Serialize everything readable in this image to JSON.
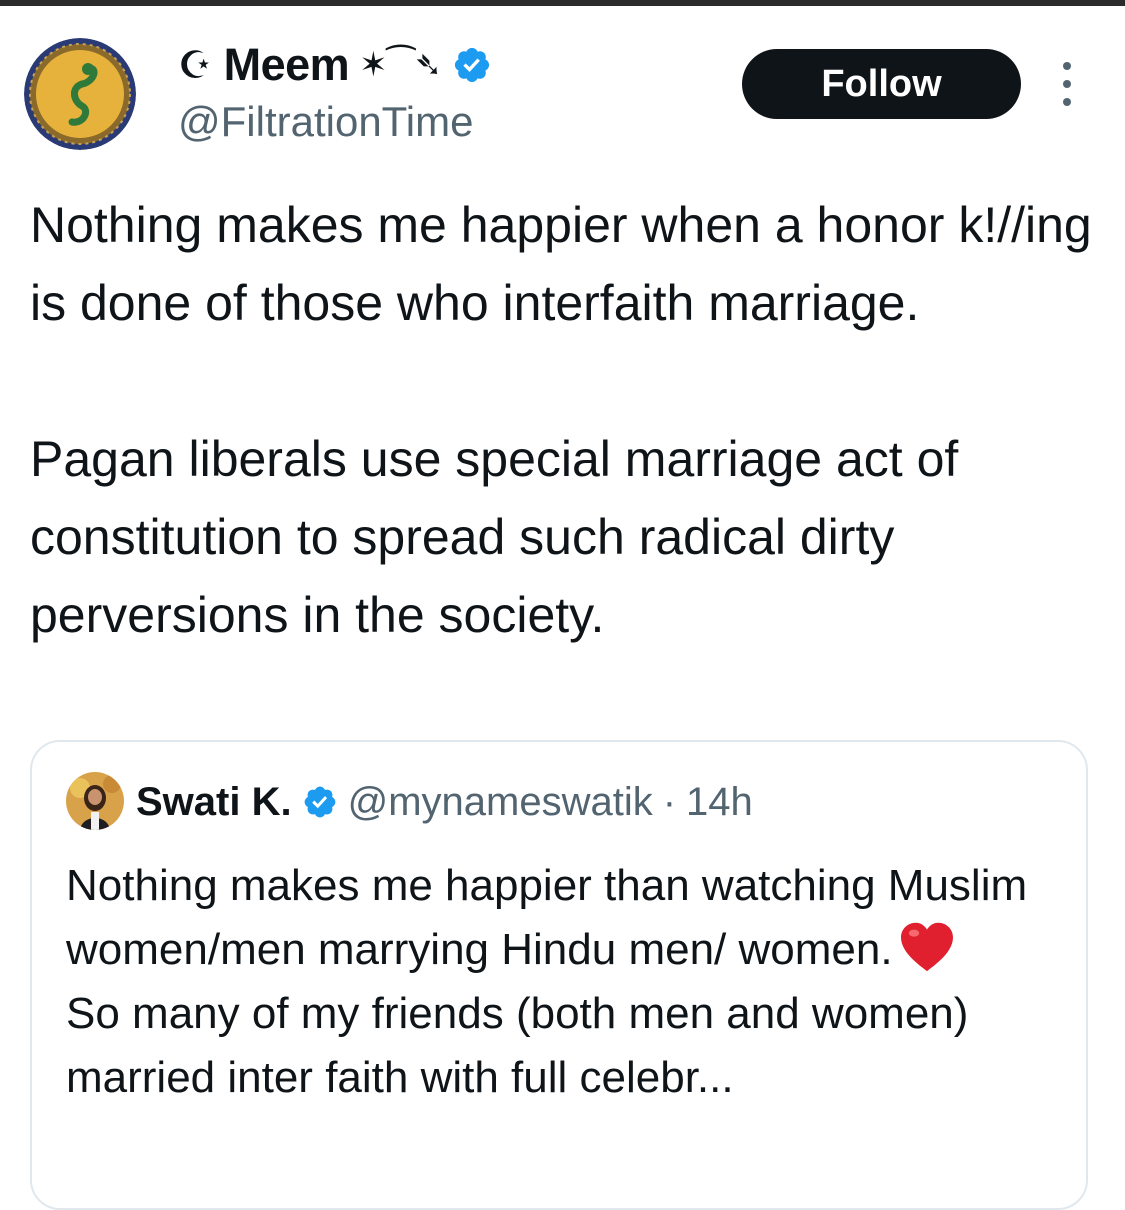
{
  "tweet": {
    "author": {
      "moon_glyph": "☪",
      "name": "Meem",
      "decoration": "✶⁀➴",
      "handle": "@FiltrationTime",
      "avatar_icon": "green-serpent-medallion"
    },
    "follow_label": "Follow",
    "more_icon": "vertical-ellipsis-icon",
    "text_paragraphs": [
      "Nothing makes me happier when a honor k!//ing is done of those who interfaith marriage.",
      "Pagan liberals use special marriage act of constitution to spread such radical dirty perversions in the society."
    ]
  },
  "quoted_tweet": {
    "author": {
      "name": "Swati K.",
      "handle": "@mynameswatik",
      "separator": "·",
      "time": "14h"
    },
    "line1": "Nothing makes me happier than watching Muslim women/men marrying Hindu men/ women.",
    "line2": "So many of my friends (both men and women) married inter faith with full celebr..."
  },
  "colors": {
    "text": "#0f1419",
    "secondary": "#536471",
    "verified": "#1d9bf0",
    "heart": "#e0202f",
    "follow_bg": "#0f1419"
  }
}
